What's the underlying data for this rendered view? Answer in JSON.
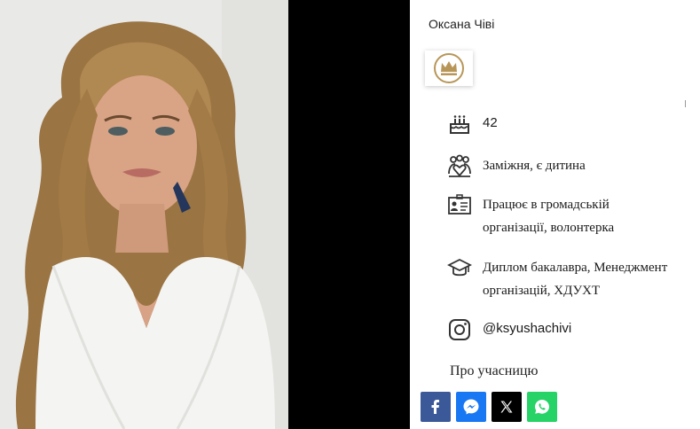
{
  "profile": {
    "name": "Оксана Чіві",
    "age": "42",
    "family": "Заміжня, є дитина",
    "work": "Працює в громадській організації, волонтерка",
    "education": "Диплом бакалавра, Менеджмент організацій, ХДУХТ",
    "instagram": "@ksyushachivi",
    "about_heading": "Про учасницю"
  },
  "icons": [
    "crown-icon",
    "birthday-cake-icon",
    "family-icon",
    "id-card-icon",
    "graduation-cap-icon",
    "instagram-icon"
  ],
  "share": [
    {
      "name": "facebook",
      "color": "#3b5998"
    },
    {
      "name": "messenger",
      "color": "#1877f2"
    },
    {
      "name": "x",
      "color": "#000000"
    },
    {
      "name": "whatsapp",
      "color": "#25d366"
    }
  ],
  "colors": {
    "crown": "#b89658",
    "icon": "#333333"
  }
}
